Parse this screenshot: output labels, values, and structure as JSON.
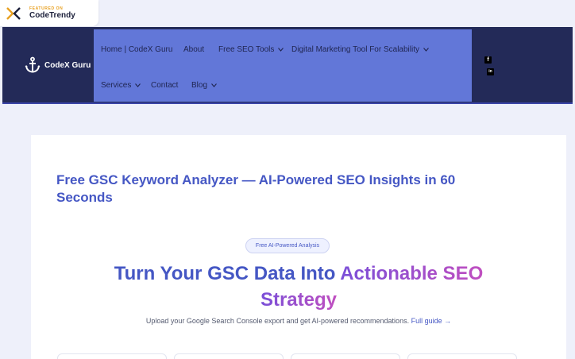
{
  "badge": {
    "small": "FEATURED ON",
    "big": "CodeTrendy"
  },
  "header": {
    "logo_text": "CodeX Guru",
    "nav": {
      "home": "Home | CodeX Guru",
      "about": "About",
      "seo_tools": "Free SEO Tools",
      "digital": "Digital Marketing Tool For Scalability",
      "services": "Services",
      "contact": "Contact",
      "blog": "Blog"
    },
    "social": {
      "facebook": "f",
      "linkedin": "in"
    }
  },
  "main": {
    "title": "Free GSC Keyword Analyzer — AI-Powered SEO Insights in 60 Seconds",
    "pill": "Free AI-Powered Analysis",
    "hero_plain": "Turn Your GSC Data Into ",
    "hero_accent_1": "Actionable SEO",
    "hero_accent_2": "Strategy",
    "subtitle": "Upload your Google Search Console export and get AI-powered recommendations.",
    "guide_link": "Full guide →"
  },
  "colors": {
    "header_bg": "#232a58",
    "nav_bg": "#6277d8",
    "accent": "#4557c4",
    "page_bg": "#eef0fa"
  }
}
